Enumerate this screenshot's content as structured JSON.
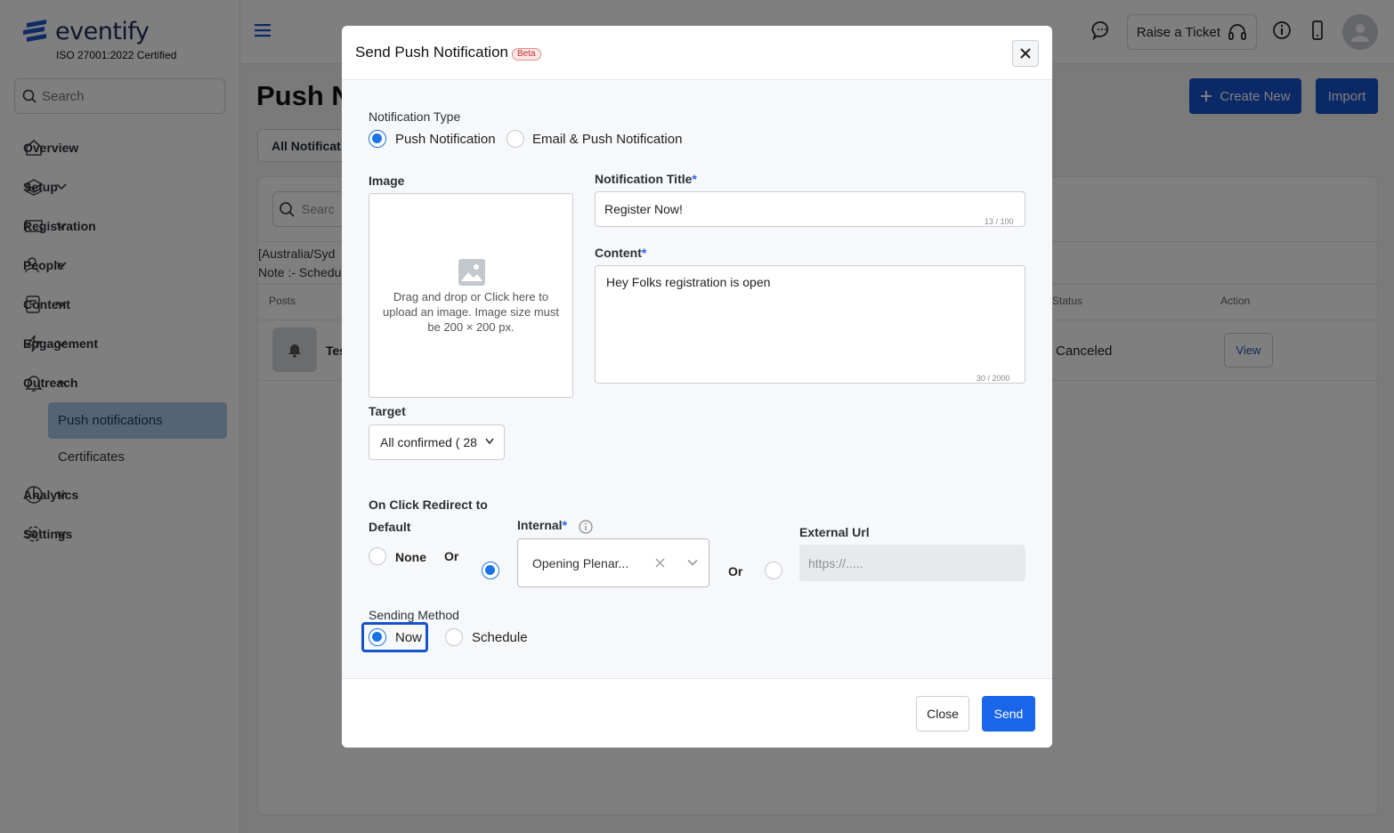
{
  "sidebar": {
    "logo_text": "eventify",
    "certification": "ISO 27001:2022 Certified",
    "search_placeholder": "Search",
    "items": [
      {
        "label": "Overview"
      },
      {
        "label": "Setup"
      },
      {
        "label": "Registration"
      },
      {
        "label": "People"
      },
      {
        "label": "Content"
      },
      {
        "label": "Engagement"
      },
      {
        "label": "Outreach"
      },
      {
        "label": "Analytics"
      },
      {
        "label": "Settings"
      }
    ],
    "outreach_sub": [
      {
        "label": "Push notifications",
        "active": true
      },
      {
        "label": "Certificates",
        "active": false
      }
    ]
  },
  "topbar": {
    "raise_ticket": "Raise a Ticket"
  },
  "page": {
    "title": "Push N",
    "create_button": "Create New",
    "import_button": "Import",
    "tab_all": "All Notificat",
    "card_search_placeholder": "Searc",
    "timezone": "[Australia/Syd",
    "note": "Note :- Schedu",
    "col_posts": "Posts",
    "col_status": "Status",
    "col_action": "Action",
    "row_name": "Tes",
    "row_status": "Canceled",
    "row_action": "View"
  },
  "modal": {
    "title": "Send Push Notification",
    "badge": "Beta",
    "notification_type_label": "Notification Type",
    "type_options": [
      "Push Notification",
      "Email & Push Notification"
    ],
    "type_selected": "Push Notification",
    "image_label": "Image",
    "image_hint": "Drag and drop or Click here to upload an image. Image size must be 200 × 200 px.",
    "title_label": "Notification Title",
    "title_value": "Register Now!",
    "title_counter": "13 / 100",
    "content_label": "Content",
    "content_value": "Hey Folks registration is open",
    "content_counter": "30 / 2000",
    "target_label": "Target",
    "target_value": "All confirmed ( 28",
    "redirect_label": "On Click Redirect to",
    "default_label": "Default",
    "none_label": "None",
    "or_label": "Or",
    "internal_label": "Internal",
    "internal_value": "Opening Plenar...",
    "external_label": "External Url",
    "external_placeholder": "https://.....",
    "redirect_selected": "Internal",
    "sending_method_label": "Sending Method",
    "method_options": [
      "Now",
      "Schedule"
    ],
    "method_selected": "Now",
    "close_button": "Close",
    "send_button": "Send"
  },
  "colors": {
    "primary": "#1552cc",
    "radio_accent": "#1a73e8",
    "active_nav": "#aac8e8",
    "beta_red": "#c52a2a"
  }
}
